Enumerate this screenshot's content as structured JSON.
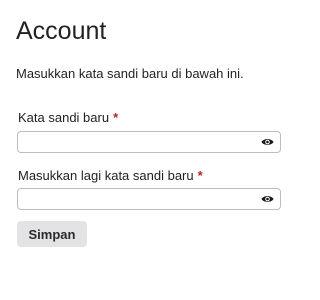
{
  "page": {
    "title": "Account",
    "instruction": "Masukkan kata sandi baru di bawah ini."
  },
  "form": {
    "new_password": {
      "label": "Kata sandi baru",
      "required_marker": "*",
      "value": "",
      "icon": "eye-icon"
    },
    "confirm_password": {
      "label": "Masukkan lagi kata sandi baru",
      "required_marker": "*",
      "value": "",
      "icon": "eye-icon"
    },
    "save_label": "Simpan"
  },
  "colors": {
    "required": "#b3261e",
    "button_bg": "#e3e3e6",
    "field_border": "#bdbdbd"
  }
}
